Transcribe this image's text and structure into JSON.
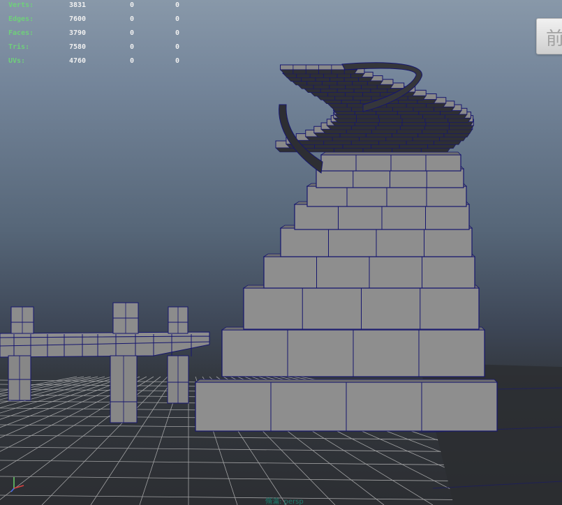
{
  "viewport": {
    "hud": {
      "rows": [
        {
          "label": "Verts:",
          "v1": "3831",
          "v2": "0",
          "v3": "0"
        },
        {
          "label": "Edges:",
          "v1": "7600",
          "v2": "0",
          "v3": "0"
        },
        {
          "label": "Faces:",
          "v1": "3790",
          "v2": "0",
          "v3": "0"
        },
        {
          "label": "Tris:",
          "v1": "7580",
          "v2": "0",
          "v3": "0"
        },
        {
          "label": "UVs:",
          "v1": "4760",
          "v2": "0",
          "v3": "0"
        }
      ]
    },
    "view_cube_label": "前",
    "camera_label": "脩瀹: persp",
    "colors": {
      "wireframe": "#16166e",
      "face": "#8e8e8e",
      "grid": "#c9c9c9",
      "hud_label": "#6fd07a",
      "hud_value": "#f0f0f0"
    }
  }
}
